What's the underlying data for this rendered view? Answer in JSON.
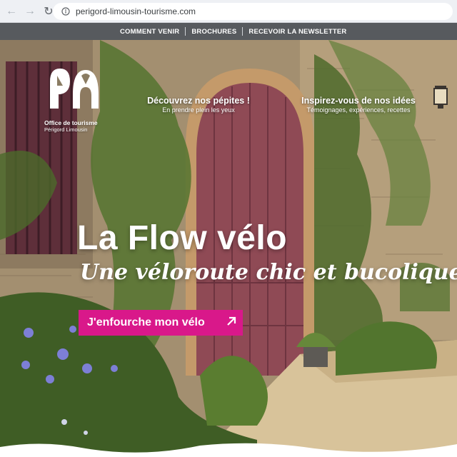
{
  "browser": {
    "url": "perigord-limousin-tourisme.com"
  },
  "site_nav": {
    "items": [
      "COMMENT VENIR",
      "BROCHURES",
      "RECEVOIR LA NEWSLETTER"
    ]
  },
  "logo": {
    "title": "Office de tourisme",
    "subtitle": "Périgord Limousin"
  },
  "promos": [
    {
      "title": "Découvrez nos pépites !",
      "subtitle": "En prendre plein les yeux"
    },
    {
      "title": "Inspirez-vous de nos idées",
      "subtitle": "Témoignages, expériences, recettes"
    }
  ],
  "hero": {
    "title": "La Flow vélo",
    "subtitle": "Une véloroute chic et bucolique",
    "cta_label": "J'enfourche mon vélo"
  },
  "colors": {
    "accent": "#d9188a",
    "nav_bg": "#575a5e",
    "door": "#8f4a55"
  }
}
